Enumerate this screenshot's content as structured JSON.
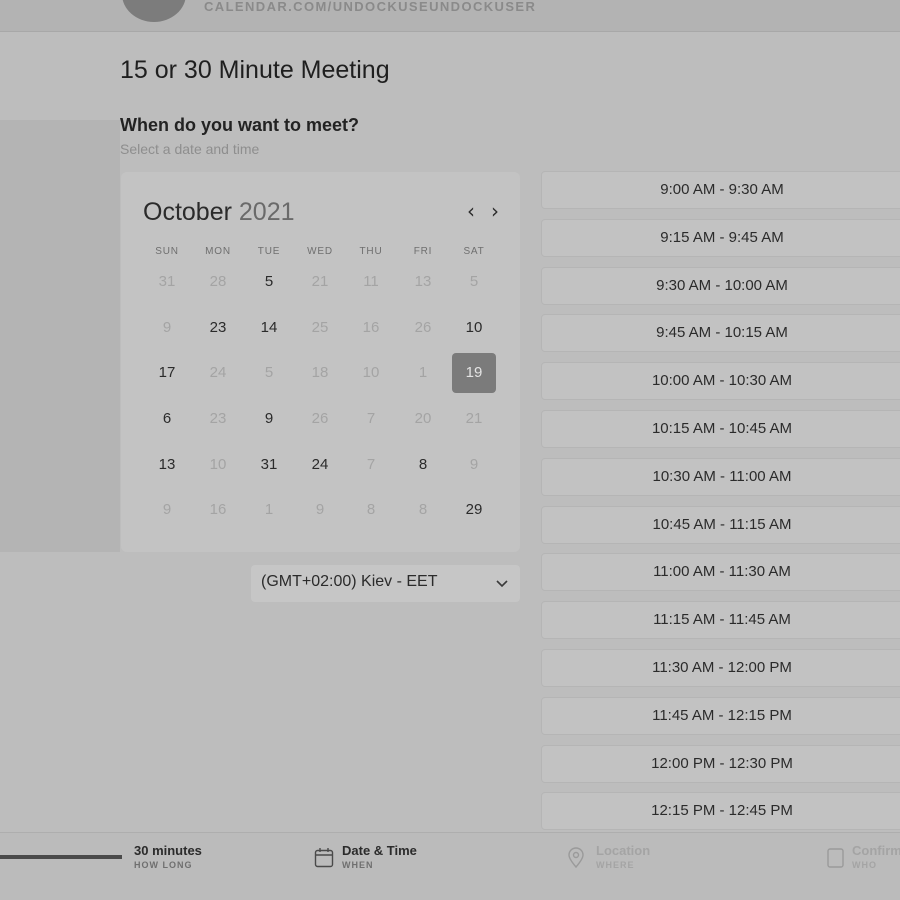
{
  "header": {
    "url": "CALENDAR.COM/UNDOCKUSEUNDOCKUSER"
  },
  "event": {
    "title": "15 or 30 Minute Meeting",
    "question": "When do you want to meet?",
    "subtitle": "Select a date and time"
  },
  "calendar": {
    "month": "October",
    "year": "2021",
    "weekdays": [
      "SUN",
      "MON",
      "TUE",
      "WED",
      "THU",
      "FRI",
      "SAT"
    ],
    "weeks": [
      [
        {
          "d": "31",
          "s": "disabled"
        },
        {
          "d": "28",
          "s": "disabled"
        },
        {
          "d": "5",
          "s": "active"
        },
        {
          "d": "21",
          "s": "disabled"
        },
        {
          "d": "11",
          "s": "disabled"
        },
        {
          "d": "13",
          "s": "disabled"
        },
        {
          "d": "5",
          "s": "disabled"
        }
      ],
      [
        {
          "d": "9",
          "s": "disabled"
        },
        {
          "d": "23",
          "s": "active"
        },
        {
          "d": "14",
          "s": "active"
        },
        {
          "d": "25",
          "s": "disabled"
        },
        {
          "d": "16",
          "s": "disabled"
        },
        {
          "d": "26",
          "s": "disabled"
        },
        {
          "d": "10",
          "s": "active"
        }
      ],
      [
        {
          "d": "17",
          "s": "active"
        },
        {
          "d": "24",
          "s": "disabled"
        },
        {
          "d": "5",
          "s": "disabled"
        },
        {
          "d": "18",
          "s": "disabled"
        },
        {
          "d": "10",
          "s": "disabled"
        },
        {
          "d": "1",
          "s": "disabled"
        },
        {
          "d": "19",
          "s": "selected"
        }
      ],
      [
        {
          "d": "6",
          "s": "active"
        },
        {
          "d": "23",
          "s": "disabled"
        },
        {
          "d": "9",
          "s": "active"
        },
        {
          "d": "26",
          "s": "disabled"
        },
        {
          "d": "7",
          "s": "disabled"
        },
        {
          "d": "20",
          "s": "disabled"
        },
        {
          "d": "21",
          "s": "disabled"
        }
      ],
      [
        {
          "d": "13",
          "s": "active"
        },
        {
          "d": "10",
          "s": "disabled"
        },
        {
          "d": "31",
          "s": "active"
        },
        {
          "d": "24",
          "s": "active"
        },
        {
          "d": "7",
          "s": "disabled"
        },
        {
          "d": "8",
          "s": "active"
        },
        {
          "d": "9",
          "s": "disabled"
        }
      ],
      [
        {
          "d": "9",
          "s": "disabled"
        },
        {
          "d": "16",
          "s": "disabled"
        },
        {
          "d": "1",
          "s": "disabled"
        },
        {
          "d": "9",
          "s": "disabled"
        },
        {
          "d": "8",
          "s": "disabled"
        },
        {
          "d": "8",
          "s": "disabled"
        },
        {
          "d": "29",
          "s": "active"
        }
      ]
    ]
  },
  "timezone": {
    "label": "(GMT+02:00) Kiev - EET"
  },
  "slots": [
    "9:00 AM - 9:30 AM",
    "9:15 AM - 9:45 AM",
    "9:30 AM - 10:00 AM",
    "9:45 AM - 10:15 AM",
    "10:00 AM - 10:30 AM",
    "10:15 AM - 10:45 AM",
    "10:30 AM - 11:00 AM",
    "10:45 AM - 11:15 AM",
    "11:00 AM - 11:30 AM",
    "11:15 AM - 11:45 AM",
    "11:30 AM - 12:00 PM",
    "11:45 AM - 12:15 PM",
    "12:00 PM - 12:30 PM",
    "12:15 PM - 12:45 PM"
  ],
  "steps": {
    "duration": {
      "title": "30 minutes",
      "sub": "HOW LONG"
    },
    "datetime": {
      "title": "Date & Time",
      "sub": "WHEN"
    },
    "location": {
      "title": "Location",
      "sub": "WHERE"
    },
    "confirm": {
      "title": "Confirm",
      "sub": "WHO"
    }
  },
  "icons": {
    "nav_prev": "chevron-left-icon",
    "nav_next": "chevron-right-icon",
    "timezone": "chevron-down-icon",
    "datetime": "calendar-icon",
    "location": "map-pin-icon",
    "confirm": "checklist-icon"
  }
}
